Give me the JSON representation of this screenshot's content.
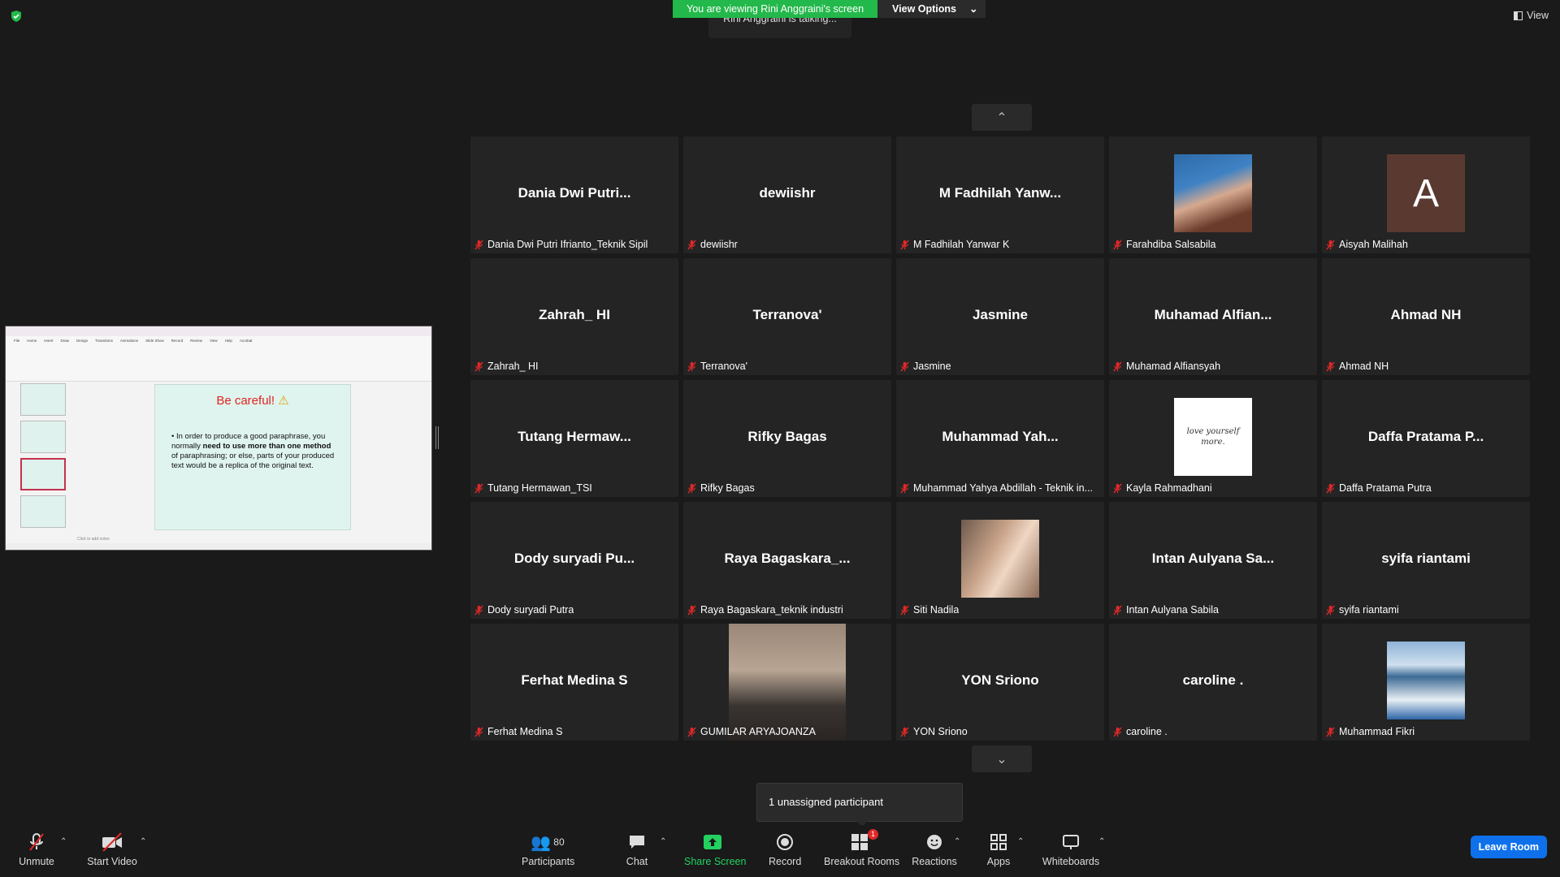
{
  "top": {
    "viewing_banner": "You are viewing Rini Anggraini's screen",
    "view_options": "View Options",
    "talking": "Rini Anggraini is talking...",
    "view": "View"
  },
  "shared_screen": {
    "ribbon_tabs": [
      "File",
      "Home",
      "Insert",
      "Draw",
      "Design",
      "Transitions",
      "Animations",
      "Slide Show",
      "Record",
      "Review",
      "View",
      "Help",
      "Acrobat"
    ],
    "slide_title": "Be careful!",
    "slide_body_pre": "In order to produce a good paraphrase, you normally ",
    "slide_body_bold": "need to use more than one method",
    "slide_body_post": " of paraphrasing; or else, parts of your produced text would be a replica of the original text.",
    "notes_placeholder": "Click to add notes"
  },
  "participants": [
    {
      "display": "Dania Dwi Putri...",
      "name": "Dania Dwi Putri Ifrianto_Teknik Sipil"
    },
    {
      "display": "dewiishr",
      "name": "dewiishr"
    },
    {
      "display": "M Fadhilah Yanw...",
      "name": "M Fadhilah Yanwar K"
    },
    {
      "display": "",
      "name": "Farahdiba Salsabila",
      "photo": "farahdiba"
    },
    {
      "display": "",
      "name": "Aisyah Malihah",
      "avatar_letter": "A"
    },
    {
      "display": "Zahrah_ HI",
      "name": "Zahrah_ HI"
    },
    {
      "display": "Terranova'",
      "name": "Terranova'"
    },
    {
      "display": "Jasmine",
      "name": "Jasmine"
    },
    {
      "display": "Muhamad Alfian...",
      "name": "Muhamad Alfiansyah"
    },
    {
      "display": "Ahmad NH",
      "name": "Ahmad NH"
    },
    {
      "display": "Tutang Hermaw...",
      "name": "Tutang Hermawan_TSI"
    },
    {
      "display": "Rifky Bagas",
      "name": "Rifky Bagas"
    },
    {
      "display": "Muhammad Yah...",
      "name": "Muhammad Yahya Abdillah - Teknik in..."
    },
    {
      "display": "",
      "name": "Kayla Rahmadhani",
      "photo": "kayla",
      "photo_text": "love yourself more."
    },
    {
      "display": "Daffa Pratama P...",
      "name": "Daffa Pratama Putra"
    },
    {
      "display": "Dody suryadi Pu...",
      "name": "Dody suryadi Putra"
    },
    {
      "display": "Raya Bagaskara_...",
      "name": "Raya Bagaskara_teknik industri"
    },
    {
      "display": "",
      "name": "Siti Nadila",
      "photo": "siti"
    },
    {
      "display": "Intan Aulyana Sa...",
      "name": "Intan Aulyana Sabila"
    },
    {
      "display": "syifa riantami",
      "name": "syifa riantami"
    },
    {
      "display": "Ferhat Medina S",
      "name": "Ferhat Medina S"
    },
    {
      "display": "",
      "name": "GUMILAR ARYAJOANZA",
      "photo": "gumilar"
    },
    {
      "display": "YON Sriono",
      "name": "YON Sriono"
    },
    {
      "display": "caroline .",
      "name": "caroline ."
    },
    {
      "display": "",
      "name": "Muhammad Fikri",
      "photo": "fikri"
    }
  ],
  "popover": "1 unassigned participant",
  "toolbar": {
    "unmute": "Unmute",
    "start_video": "Start Video",
    "participants": "Participants",
    "participants_count": "80",
    "chat": "Chat",
    "share_screen": "Share Screen",
    "record": "Record",
    "breakout_rooms": "Breakout Rooms",
    "breakout_badge": "1",
    "reactions": "Reactions",
    "apps": "Apps",
    "whiteboards": "Whiteboards",
    "leave_room": "Leave Room"
  },
  "colors": {
    "background": "#1a1a1a",
    "tile": "#242424",
    "green_banner": "#23b84b",
    "leave_button": "#0e71eb",
    "muted_red": "#e02828"
  }
}
